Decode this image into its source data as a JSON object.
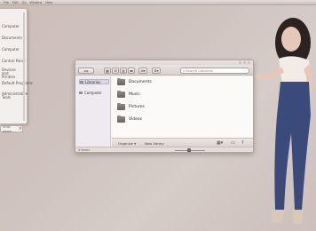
{
  "topbar": {
    "items": [
      "File",
      "Edit",
      "Go",
      "Window",
      "Help"
    ]
  },
  "startmenu": {
    "items": [
      "Computer",
      "Documents",
      "Computer",
      "Control Panel",
      "Devices and Printers",
      "Default Programs",
      "Administrative Tools"
    ]
  },
  "search_pill": {
    "label": "Shut down"
  },
  "explorer": {
    "breadcrumb": "Computer",
    "search_placeholder": "Search Libraries",
    "sidebar": {
      "items": [
        "Libraries",
        "Computer"
      ]
    },
    "folders": [
      "Documents",
      "Music",
      "Pictures",
      "Videos"
    ],
    "bottombar": {
      "organize": "Organize ▾",
      "new_library": "New library"
    },
    "status": "4 items"
  },
  "colors": {
    "wallpaper": "#cfc3be",
    "folder_icon": "#7a726f",
    "jeans": "#3a4a7a"
  }
}
